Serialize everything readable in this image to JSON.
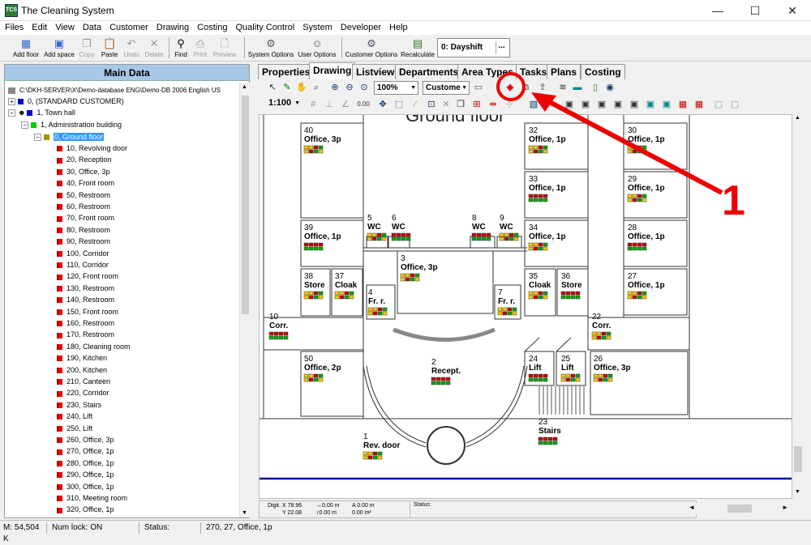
{
  "window": {
    "title": "The Cleaning System",
    "minimize": "—",
    "maximize": "☐",
    "close": "✕"
  },
  "menu": [
    "Files",
    "Edit",
    "View",
    "Data",
    "Customer",
    "Drawing",
    "Costing",
    "Quality Control",
    "System",
    "Developer",
    "Help"
  ],
  "toolbar": {
    "add_floor": "Add floor",
    "add_space": "Add space",
    "copy": "Copy",
    "paste": "Paste",
    "undo": "Undo",
    "delete": "Delete",
    "find": "Find",
    "print": "Print",
    "preview": "Preview",
    "system_options": "System Options",
    "user_options": "User Options",
    "customer_options": "Customer Options",
    "recalculate": "Recalculate",
    "shift": "0: Dayshift",
    "shift_btn": "..."
  },
  "left_panel": {
    "title": "Main Data",
    "path": "C:\\DKH-SERVER\\X\\Demo-database ENG\\Demo-DB 2006 English US",
    "root": "0, (STANDARD CUSTOMER)",
    "customer": "1, Town hall",
    "building": "1, Administration building",
    "floor": "0, Ground floor",
    "rooms": [
      "10, Revolving door",
      "20, Reception",
      "30, Office, 3p",
      "40, Front room",
      "50, Restroom",
      "60, Restroom",
      "70, Front room",
      "80, Restroom",
      "90, Restroom",
      "100, Corridor",
      "110, Corridor",
      "120, Front room",
      "130, Restroom",
      "140, Restroom",
      "150, Front room",
      "160, Restroom",
      "170, Restroom",
      "180, Cleaning room",
      "190, Kitchen",
      "200, Kitchen",
      "210, Canteen",
      "220, Corridor",
      "230, Stairs",
      "240, Lift",
      "250, Lift",
      "260, Office, 3p",
      "270, Office, 1p",
      "280, Office, 1p",
      "290, Office, 1p",
      "300, Office, 1p",
      "310, Meeting room",
      "320, Office, 1p"
    ]
  },
  "tabs": [
    "Properties",
    "Drawing",
    "Listview",
    "Departments",
    "Area Types",
    "Tasks",
    "Plans",
    "Costing"
  ],
  "active_tab": "Drawing",
  "drawing_toolbar": {
    "zoom": "100%",
    "mode": "Custome",
    "scale": "1:100",
    "value": "0.00"
  },
  "canvas": {
    "floor_title": "Ground floor",
    "rooms": [
      {
        "num": "40",
        "name": "Office, 3p"
      },
      {
        "num": "39",
        "name": "Office, 1p"
      },
      {
        "num": "38",
        "name": "Store"
      },
      {
        "num": "37",
        "name": "Cloak"
      },
      {
        "num": "10",
        "name": "Corr."
      },
      {
        "num": "50",
        "name": "Office, 2p"
      },
      {
        "num": "5",
        "name": "WC"
      },
      {
        "num": "6",
        "name": "WC"
      },
      {
        "num": "4",
        "name": "Fr. r."
      },
      {
        "num": "3",
        "name": "Office, 3p"
      },
      {
        "num": "8",
        "name": "WC"
      },
      {
        "num": "9",
        "name": "WC"
      },
      {
        "num": "7",
        "name": "Fr. r."
      },
      {
        "num": "2",
        "name": "Recept."
      },
      {
        "num": "1",
        "name": "Rev. door"
      },
      {
        "num": "32",
        "name": "Office, 1p"
      },
      {
        "num": "33",
        "name": "Office, 1p"
      },
      {
        "num": "34",
        "name": "Office, 1p"
      },
      {
        "num": "35",
        "name": "Cloak"
      },
      {
        "num": "36",
        "name": "Store"
      },
      {
        "num": "30",
        "name": "Office, 1p"
      },
      {
        "num": "29",
        "name": "Office, 1p"
      },
      {
        "num": "28",
        "name": "Office, 1p"
      },
      {
        "num": "27",
        "name": "Office, 1p"
      },
      {
        "num": "22",
        "name": "Corr."
      },
      {
        "num": "24",
        "name": "Lift"
      },
      {
        "num": "25",
        "name": "Lift"
      },
      {
        "num": "26",
        "name": "Office, 3p"
      },
      {
        "num": "23",
        "name": "Stairs"
      }
    ]
  },
  "canvas_status": {
    "digit": "Digit.",
    "x": "X 78.96",
    "y": "Y 22.08",
    "dx": "↔0.00 m",
    "dy": "↕0.00 m",
    "a": "A 0.00 m",
    "area": "0.00 m²",
    "status": "Status:"
  },
  "status_bar": {
    "memory": "M: 54,504 K",
    "numlock": "Num lock: ON",
    "status_label": "Status:",
    "selection": "270, 27, Office, 1p"
  },
  "annotation": {
    "label": "1",
    "color": "#e00000"
  }
}
